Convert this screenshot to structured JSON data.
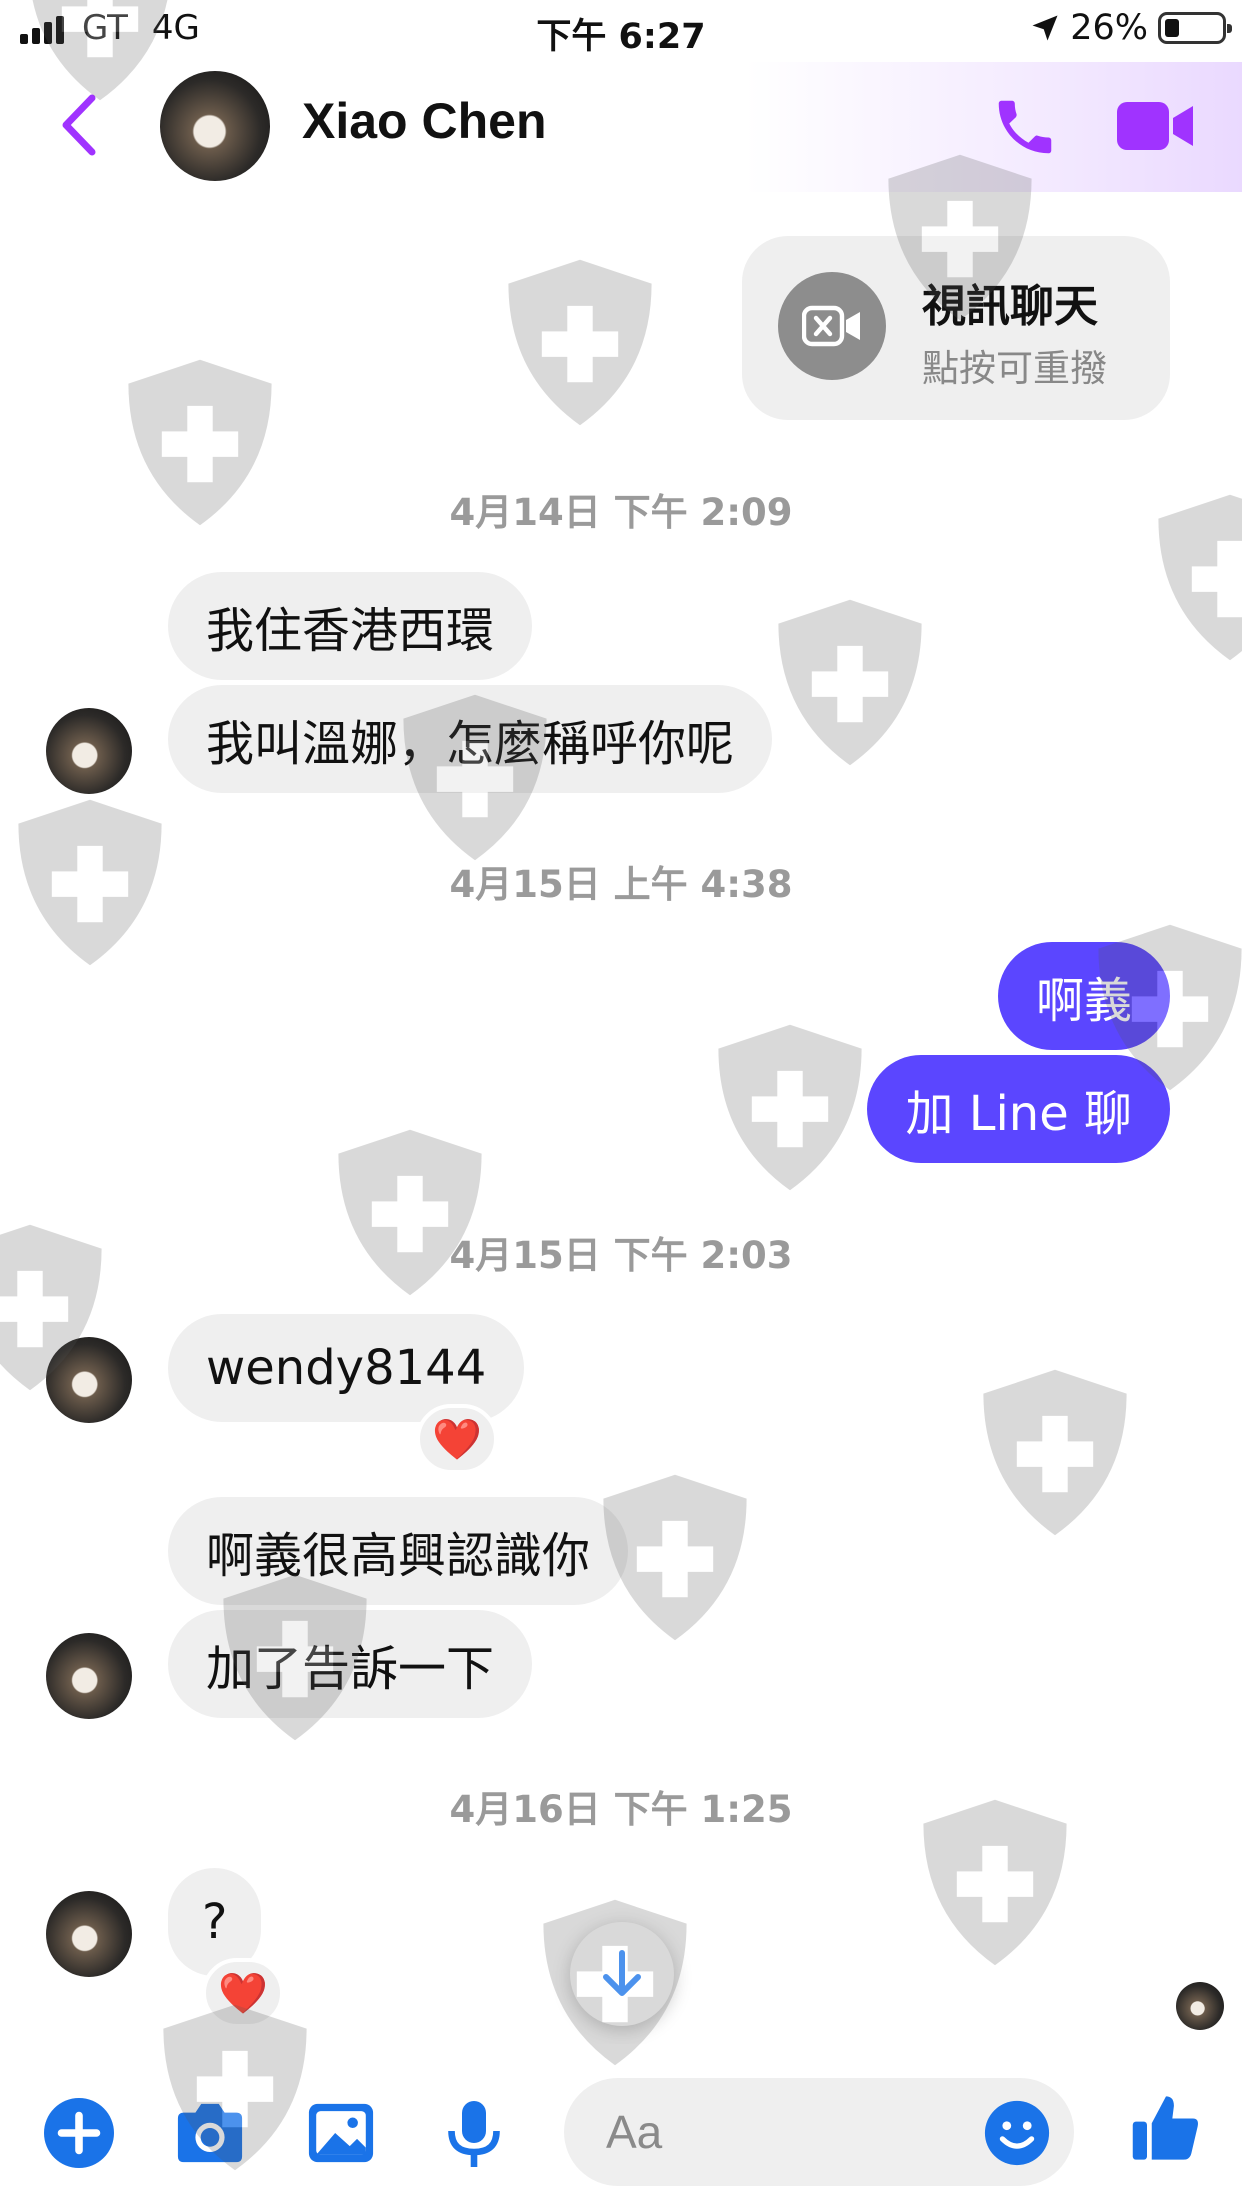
{
  "status_bar": {
    "carrier": "GT",
    "network": "4G",
    "time": "下午 6:27",
    "battery_percent": "26%",
    "battery_level": 0.26
  },
  "header": {
    "contact_name": "Xiao Chen",
    "back_icon": "chevron-left-icon",
    "call_icon": "phone-icon",
    "video_icon": "video-camera-icon",
    "accent_color": "#a033ff"
  },
  "messages": {
    "call_card": {
      "title": "視訊聊天",
      "subtitle": "點按可重撥",
      "icon": "missed-video-icon"
    },
    "timestamps": [
      "4月14日 下午 2:09",
      "4月15日 上午 4:38",
      "4月15日 下午 2:03",
      "4月16日 下午 1:25"
    ],
    "incoming": [
      "我住香港西環",
      "我叫溫娜，怎麼稱呼你呢",
      "wendy8144",
      "啊義很高興認識你",
      "加了告訴一下",
      "?"
    ],
    "outgoing": [
      "啊義",
      "加 Line 聊"
    ],
    "reactions": [
      "❤️",
      "❤️"
    ],
    "scroll_icon": "arrow-down-icon",
    "outgoing_color": "#5b46ff",
    "incoming_color": "#efefef"
  },
  "composer": {
    "placeholder": "Aa",
    "icons": [
      "plus-icon",
      "camera-icon",
      "image-icon",
      "microphone-icon",
      "emoji-icon",
      "thumbs-up-icon"
    ],
    "icon_color": "#1a73e8"
  }
}
